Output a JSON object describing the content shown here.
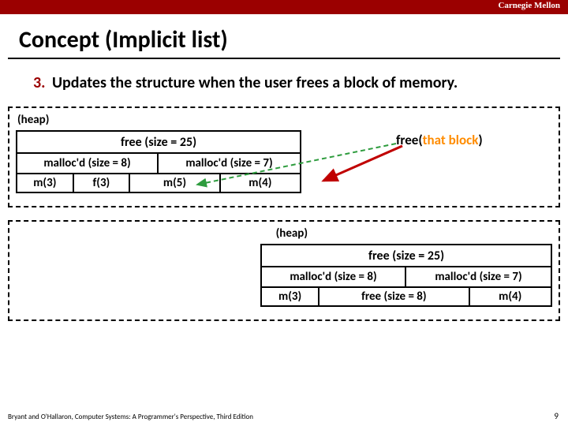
{
  "brand": "Carnegie Mellon",
  "title": "Concept (Implicit list)",
  "step": {
    "num": "3.",
    "text": "Updates the structure when the user frees a block of memory."
  },
  "marker": "(heap)",
  "free_row": "free (size = 25)",
  "heap1": {
    "mallocA": "malloc'd (size = 8)",
    "mallocB": "malloc'd (size = 7)",
    "m3": "m(3)",
    "f3": "f(3)",
    "m5": "m(5)",
    "m4": "m(4)"
  },
  "call": {
    "fn": "free(",
    "arg": "that block",
    "close": ")"
  },
  "heap2": {
    "mallocA": "malloc'd (size = 8)",
    "mallocB": "malloc'd (size = 7)",
    "m3": "m(3)",
    "free8": "free (size = 8)",
    "m4": "m(4)"
  },
  "footer": "Bryant and O'Hallaron, Computer Systems: A Programmer's Perspective, Third Edition",
  "page": "9"
}
